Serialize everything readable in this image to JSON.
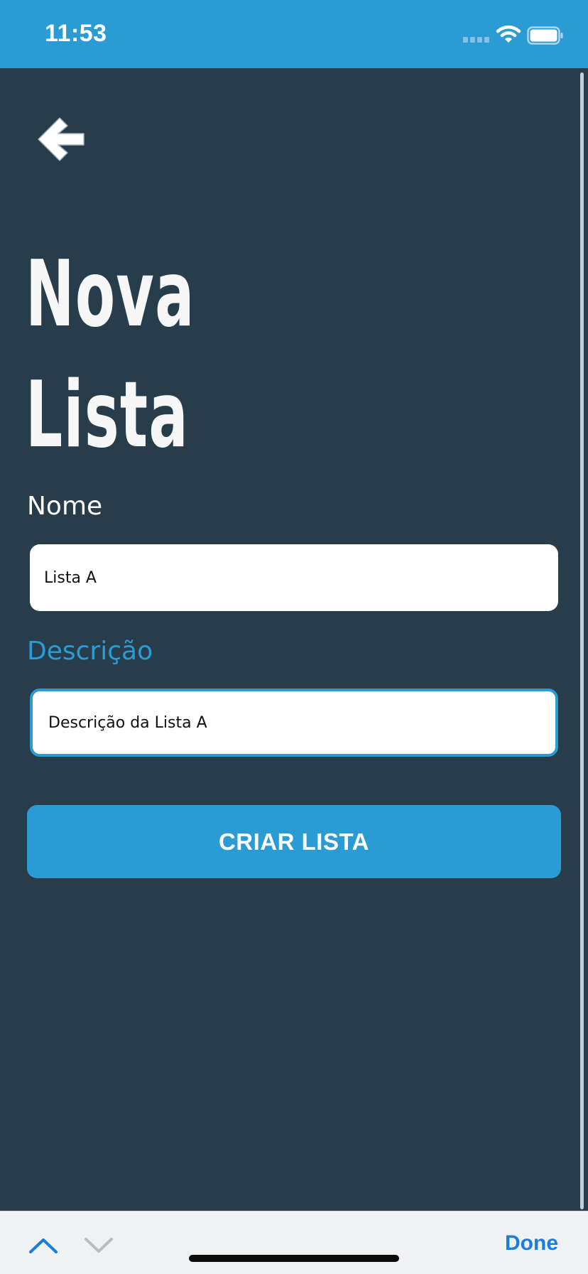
{
  "status_bar": {
    "time": "11:53"
  },
  "screen": {
    "back_icon": "arrow-left-icon",
    "title_line1": "Nova",
    "title_line2": "Lista"
  },
  "form": {
    "name_label": "Nome",
    "name_value": "Lista A",
    "description_label": "Descrição",
    "description_value": "Descrição da Lista A",
    "submit_label": "CRIAR LISTA"
  },
  "keyboard_toolbar": {
    "previous_icon": "chevron-up-icon",
    "next_icon": "chevron-down-icon",
    "done_label": "Done"
  },
  "colors": {
    "background": "#273d4c",
    "accent": "#2a9bd3",
    "title": "#f7f7f7",
    "toolbar_action": "#1a7de0"
  }
}
